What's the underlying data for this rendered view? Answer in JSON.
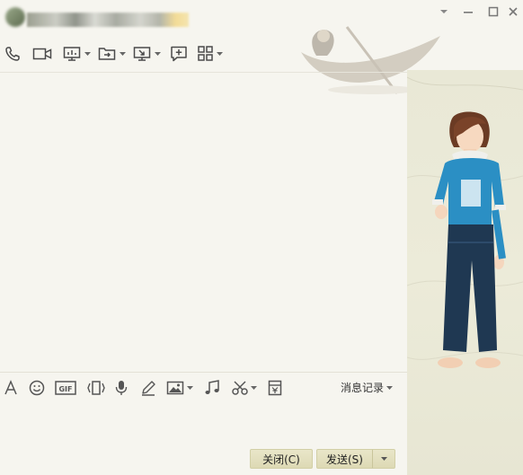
{
  "window": {
    "title_redacted": true
  },
  "input_toolbar": {
    "history_label": "消息记录"
  },
  "buttons": {
    "close_label": "关闭(C)",
    "send_label": "发送(S)"
  },
  "icons": {
    "toolbar": [
      "phone-icon",
      "video-icon",
      "screen-share-icon",
      "file-transfer-icon",
      "remote-desktop-icon",
      "add-chat-icon",
      "apps-icon"
    ],
    "input_toolbar": [
      "font-icon",
      "emoji-icon",
      "gif-icon",
      "shake-icon",
      "voice-icon",
      "handwrite-icon",
      "image-icon",
      "music-icon",
      "screenshot-icon",
      "red-packet-icon"
    ]
  },
  "colors": {
    "background": "#f6f5ef",
    "side_panel": "#e9e8d6",
    "button": "#e3e0c1"
  }
}
